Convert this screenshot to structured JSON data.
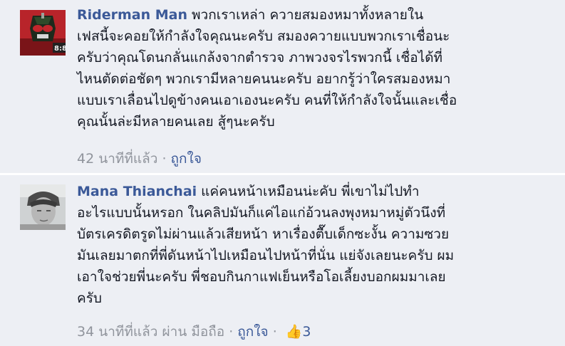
{
  "comments": [
    {
      "author": "Riderman Man",
      "lines": [
        "พวกเราเหล่า ควายสมองหมาทั้งหลายใน",
        "เฟสนี้จะคอยให้กำลังใจคุณนะครับ สมองควายแบบพวกเราเชื่อนะ",
        "ครับว่าคุณโดนกลั่นแกล้งจากตำรวจ ภาพวงจรไรพวกนี้ เชื่อได้ที่",
        "ไหนตัดต่อชัดๆ พวกเรามีหลายคนนะครับ อยากรู้ว่าใครสมองหมา",
        "แบบเราเลื่อนไปดูข้างคนเอาเองนะครับ คนที่ให้กำลังใจนั้นและเชื่อ",
        "คุณนั้นล่ะมีหลายคนเลย สู้ๆนะครับ"
      ],
      "time": "42 นาทีที่แล้ว",
      "separator": "·",
      "like_label": "ถูกใจ"
    },
    {
      "author": "Mana Thianchai",
      "lines": [
        "แค่คนหน้าเหมือนน่ะคับ พี่เขาไม่ไปทำ",
        "อะไรแบบนั้นหรอก ในคลิปมันก็แค่ไอแก่อ้วนลงพุงหมาหมู่ตัวนึงที่",
        "บัตรเครดิตรูดไม่ผ่านแล้วเสียหน้า หาเรื่องตื๊บเด็กซะงั้น ความซวย",
        "มันเลยมาตกที่พี่ดันหน้าไปเหมือนไปหน้าที่นั่น แย่จังเลยนะครับ ผม",
        "เอาใจช่วยพี่นะครับ พี่ชอบกินกาแฟเย็นหรือโอเลี้ยงบอกผมมาเลย",
        "ครับ"
      ],
      "time": "34 นาทีที่แล้ว",
      "via": "ผ่าน มือถือ",
      "separator": "·",
      "like_label": "ถูกใจ",
      "like_count": "3"
    }
  ]
}
